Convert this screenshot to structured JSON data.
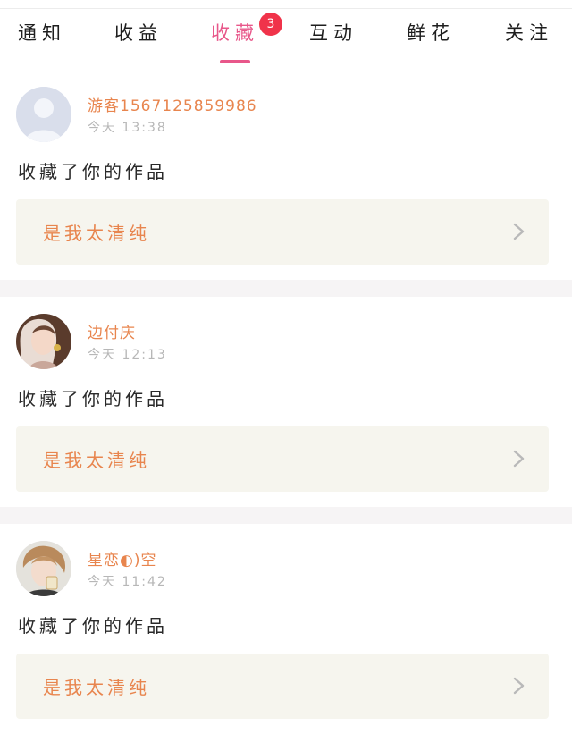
{
  "tabs": [
    {
      "label": "通知",
      "active": false
    },
    {
      "label": "收益",
      "active": false
    },
    {
      "label": "收藏",
      "active": true,
      "badge": "3"
    },
    {
      "label": "互动",
      "active": false
    },
    {
      "label": "鲜花",
      "active": false
    },
    {
      "label": "关注",
      "active": false
    }
  ],
  "colors": {
    "accent": "#e8578a",
    "name": "#e8854e",
    "badge": "#f0334a",
    "card_bg": "#f6f5ee"
  },
  "feed": [
    {
      "username": "游客15671258599​86",
      "time": "今天  13:38",
      "action": "收藏了你的作品",
      "work_title": "是我太清纯",
      "avatar_icon": "default-user-icon"
    },
    {
      "username": "边付庆",
      "time": "今天  12:13",
      "action": "收藏了你的作品",
      "work_title": "是我太清纯",
      "avatar_icon": "user-photo"
    },
    {
      "username": "星恋◐)空",
      "time": "今天  11:42",
      "action": "收藏了你的作品",
      "work_title": "是我太清纯",
      "avatar_icon": "user-photo"
    }
  ]
}
